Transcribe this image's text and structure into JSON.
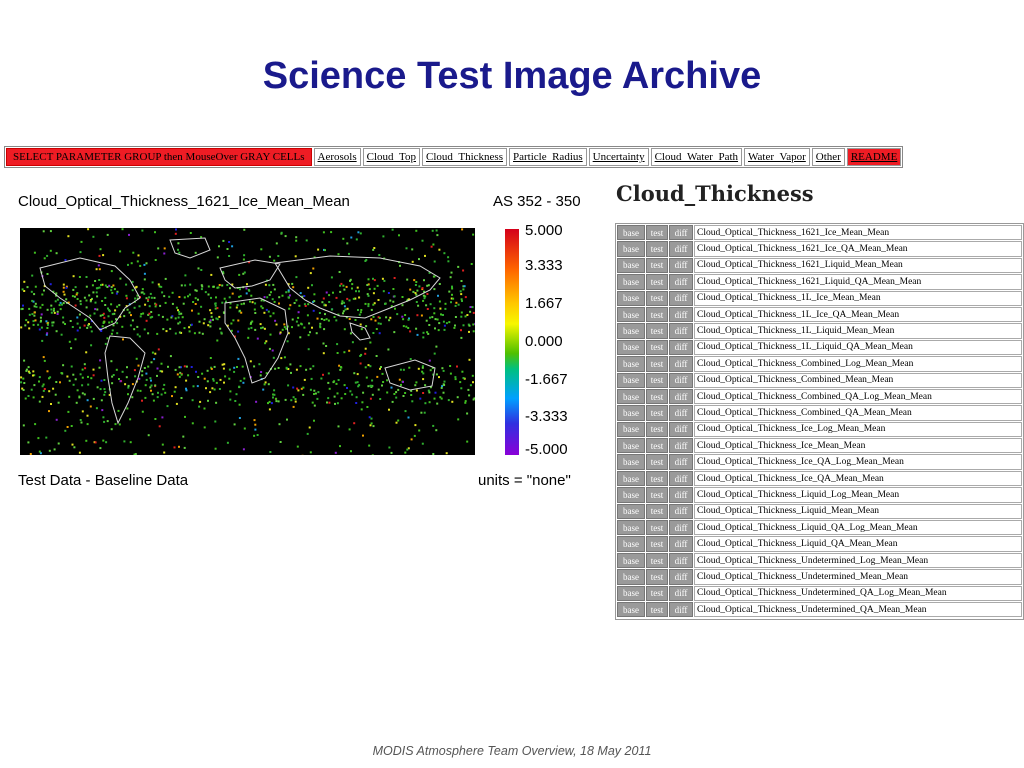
{
  "slide": {
    "title": "Science Test Image Archive",
    "footer": "MODIS Atmosphere Team Overview, 18 May 2011"
  },
  "navbar": {
    "items": [
      {
        "label": "SELECT PARAMETER GROUP then MouseOver GRAY CELLs",
        "style": "red"
      },
      {
        "label": "Aerosols"
      },
      {
        "label": "Cloud_Top"
      },
      {
        "label": "Cloud_Thickness"
      },
      {
        "label": "Particle_Radius"
      },
      {
        "label": "Uncertainty"
      },
      {
        "label": "Cloud_Water_Path"
      },
      {
        "label": "Water_Vapor"
      },
      {
        "label": "Other"
      },
      {
        "label": "README",
        "style": "readme"
      }
    ]
  },
  "plot": {
    "title": "Cloud_Optical_Thickness_1621_Ice_Mean_Mean",
    "code": "AS 352 - 350",
    "colorbar_labels": [
      "5.000",
      "3.333",
      "1.667",
      "0.000",
      "-1.667",
      "-3.333",
      "-5.000"
    ],
    "footer_left": "Test Data - Baseline Data",
    "units": "units = \"none\""
  },
  "group": {
    "heading": "Cloud_Thickness",
    "button_labels": {
      "base": "base",
      "test": "test",
      "diff": "diff"
    },
    "rows": [
      "Cloud_Optical_Thickness_1621_Ice_Mean_Mean",
      "Cloud_Optical_Thickness_1621_Ice_QA_Mean_Mean",
      "Cloud_Optical_Thickness_1621_Liquid_Mean_Mean",
      "Cloud_Optical_Thickness_1621_Liquid_QA_Mean_Mean",
      "Cloud_Optical_Thickness_1L_Ice_Mean_Mean",
      "Cloud_Optical_Thickness_1L_Ice_QA_Mean_Mean",
      "Cloud_Optical_Thickness_1L_Liquid_Mean_Mean",
      "Cloud_Optical_Thickness_1L_Liquid_QA_Mean_Mean",
      "Cloud_Optical_Thickness_Combined_Log_Mean_Mean",
      "Cloud_Optical_Thickness_Combined_Mean_Mean",
      "Cloud_Optical_Thickness_Combined_QA_Log_Mean_Mean",
      "Cloud_Optical_Thickness_Combined_QA_Mean_Mean",
      "Cloud_Optical_Thickness_Ice_Log_Mean_Mean",
      "Cloud_Optical_Thickness_Ice_Mean_Mean",
      "Cloud_Optical_Thickness_Ice_QA_Log_Mean_Mean",
      "Cloud_Optical_Thickness_Ice_QA_Mean_Mean",
      "Cloud_Optical_Thickness_Liquid_Log_Mean_Mean",
      "Cloud_Optical_Thickness_Liquid_Mean_Mean",
      "Cloud_Optical_Thickness_Liquid_QA_Log_Mean_Mean",
      "Cloud_Optical_Thickness_Liquid_QA_Mean_Mean",
      "Cloud_Optical_Thickness_Undetermined_Log_Mean_Mean",
      "Cloud_Optical_Thickness_Undetermined_Mean_Mean",
      "Cloud_Optical_Thickness_Undetermined_QA_Log_Mean_Mean",
      "Cloud_Optical_Thickness_Undetermined_QA_Mean_Mean"
    ]
  },
  "colors": {
    "title": "#1a1a8c",
    "select_bar": "#ee1c24",
    "gray_button": "#9a9a9a"
  }
}
